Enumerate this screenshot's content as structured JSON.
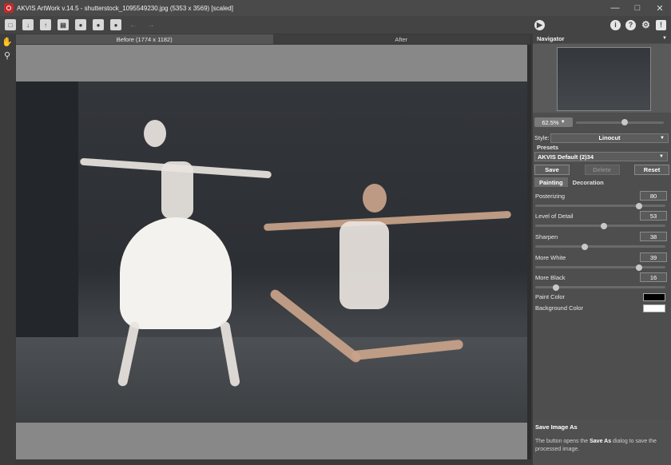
{
  "window": {
    "title": "AKVIS ArtWork v.14.5 - shutterstock_1095549230.jpg (5353 x 3569) [scaled]",
    "minimize_icon": "minimize-icon",
    "maximize_icon": "maximize-icon",
    "close_icon": "close-icon"
  },
  "toolbar": {
    "buttons": [
      "open-icon",
      "save-icon",
      "publish-icon",
      "print-icon",
      "batch-icon",
      "batch-save-icon",
      "batch-publish-icon",
      "undo-icon",
      "redo-icon"
    ],
    "run_icon": "play-icon",
    "right_icons": [
      "info-icon",
      "help-icon",
      "settings-icon",
      "notification-icon"
    ]
  },
  "left_tools": [
    "hand-icon",
    "zoom-icon"
  ],
  "view_tabs": {
    "before": "Before (1774 x 1182)",
    "after": "After"
  },
  "navigator": {
    "title": "Navigator",
    "zoom": "62.5%",
    "zoom_level": 0.55
  },
  "settings": {
    "style_label": "Style:",
    "style_value": "Linocut",
    "presets_label": "Presets",
    "preset_value": "AKVIS Default (2)34",
    "save_label": "Save",
    "delete_label": "Delete",
    "reset_label": "Reset",
    "tabs": [
      "Painting",
      "Decoration"
    ],
    "params": [
      {
        "label": "Posterizing",
        "value": "80",
        "level": 0.8
      },
      {
        "label": "Level of Detail",
        "value": "53",
        "level": 0.53
      },
      {
        "label": "Sharpen",
        "value": "38",
        "level": 0.38
      },
      {
        "label": "More White",
        "value": "39",
        "level": 0.8
      },
      {
        "label": "More Black",
        "value": "16",
        "level": 0.16
      }
    ],
    "paint_color_label": "Paint Color",
    "paint_color": "#000000",
    "background_color_label": "Background Color",
    "background_color": "#ffffff"
  },
  "hint": {
    "title": "Save Image As",
    "body_pre": "The button opens the ",
    "body_bold": "Save As",
    "body_post": " dialog to save the processed image."
  }
}
